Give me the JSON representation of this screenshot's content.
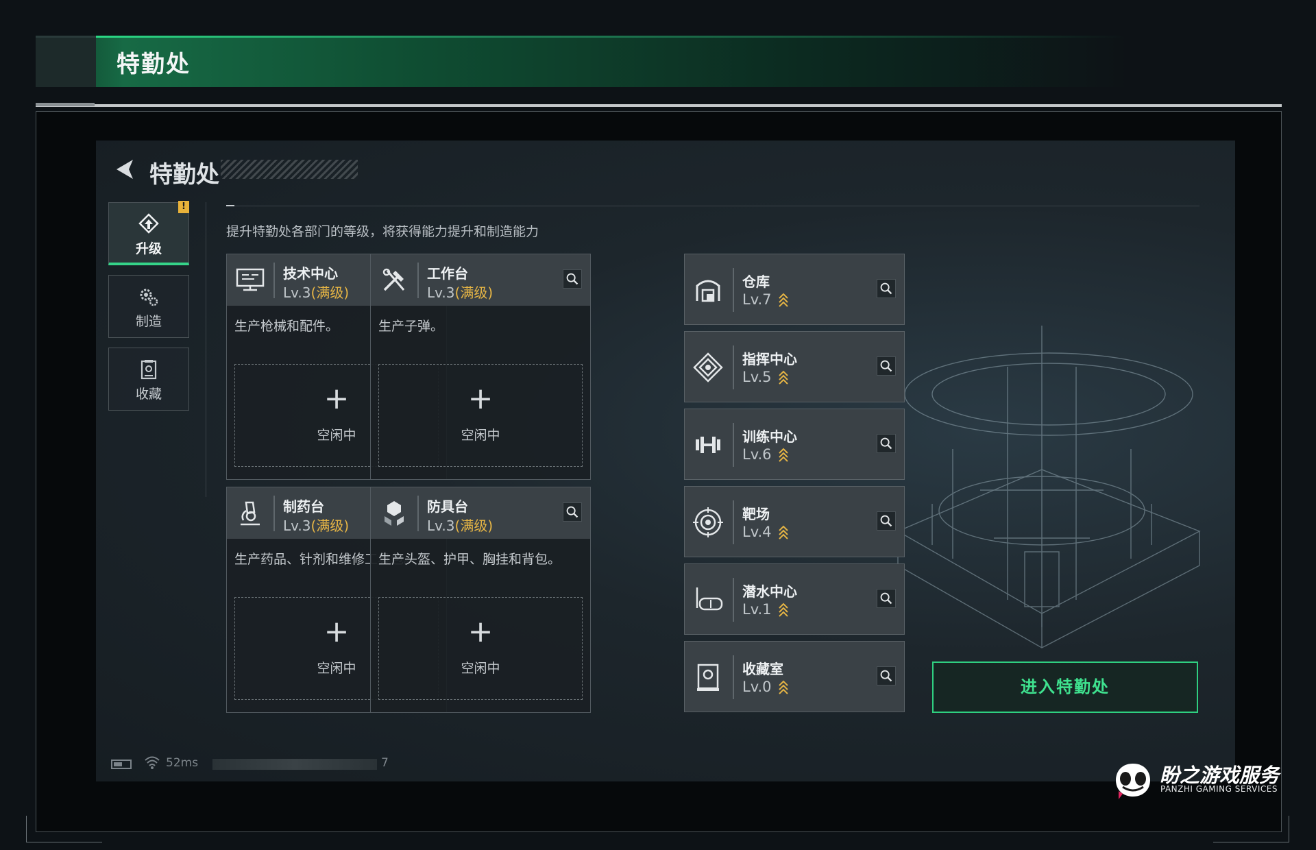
{
  "banner": {
    "title": "特勤处"
  },
  "screen": {
    "title": "特勤处",
    "description": "提升特勤处各部门的等级，将获得能力提升和制造能力"
  },
  "nav": [
    {
      "label": "升级",
      "icon": "upgrade-icon",
      "active": true,
      "badge": "!"
    },
    {
      "label": "制造",
      "icon": "gears-icon",
      "active": false
    },
    {
      "label": "收藏",
      "icon": "collection-icon",
      "active": false
    }
  ],
  "departments": [
    {
      "name": "技术中心",
      "level": "Lv.3",
      "max": "(满级)",
      "desc": "生产枪械和配件。",
      "slot_label": "空闲中",
      "icon": "monitor-icon"
    },
    {
      "name": "工作台",
      "level": "Lv.3",
      "max": "(满级)",
      "desc": "生产子弹。",
      "slot_label": "空闲中",
      "icon": "tools-icon"
    },
    {
      "name": "制药台",
      "level": "Lv.3",
      "max": "(满级)",
      "desc": "生产药品、针剂和维修工具包。",
      "slot_label": "空闲中",
      "icon": "microscope-icon"
    },
    {
      "name": "防具台",
      "level": "Lv.3",
      "max": "(满级)",
      "desc": "生产头盔、护甲、胸挂和背包。",
      "slot_label": "空闲中",
      "icon": "armor-icon"
    }
  ],
  "facilities": [
    {
      "name": "仓库",
      "level": "Lv.7",
      "icon": "warehouse-icon"
    },
    {
      "name": "指挥中心",
      "level": "Lv.5",
      "icon": "command-icon"
    },
    {
      "name": "训练中心",
      "level": "Lv.6",
      "icon": "dumbbell-icon"
    },
    {
      "name": "靶场",
      "level": "Lv.4",
      "icon": "target-icon"
    },
    {
      "name": "潜水中心",
      "level": "Lv.1",
      "icon": "diving-mask-icon"
    },
    {
      "name": "收藏室",
      "level": "Lv.0",
      "icon": "display-case-icon"
    }
  ],
  "enter_button": "进入特勤处",
  "status": {
    "ping": "52ms",
    "num": "7"
  },
  "watermark": {
    "cn": "盼之游戏服务",
    "en": "PANZHI GAMING SERVICES"
  },
  "colors": {
    "accent": "#35d489",
    "max_level": "#e6b545",
    "panel": "#3a4146"
  }
}
